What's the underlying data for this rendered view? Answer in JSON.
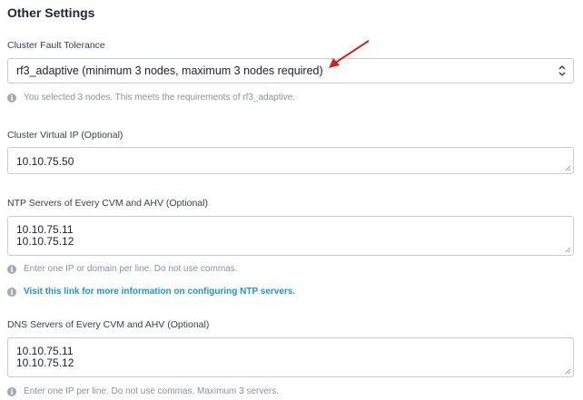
{
  "section": {
    "title": "Other Settings"
  },
  "fault_tolerance": {
    "label": "Cluster Fault Tolerance",
    "selected": "rf3_adaptive (minimum 3 nodes, maximum 3 nodes required)",
    "hint": "You selected 3 nodes. This meets the requirements of rf3_adaptive."
  },
  "virtual_ip": {
    "label": "Cluster Virtual IP (Optional)",
    "value": "10.10.75.50"
  },
  "ntp": {
    "label": "NTP Servers of Every CVM and AHV (Optional)",
    "lines": [
      "10.10.75.11",
      "10.10.75.12"
    ],
    "hint": "Enter one IP or domain per line. Do not use commas.",
    "link": "Visit this link for more information on configuring NTP servers."
  },
  "dns": {
    "label": "DNS Servers of Every CVM and AHV (Optional)",
    "lines": [
      "10.10.75.11",
      "10.10.75.12"
    ],
    "hint": "Enter one IP per line. Do not use commas. Maximum 3 servers."
  },
  "colors": {
    "annotation_arrow": "#d42020",
    "link": "#1f93d6",
    "info_icon": "#a3a9b0"
  },
  "icons": {
    "select_caret": "chevron-up-down-icon",
    "info": "info-icon",
    "annotation": "arrow-icon"
  }
}
